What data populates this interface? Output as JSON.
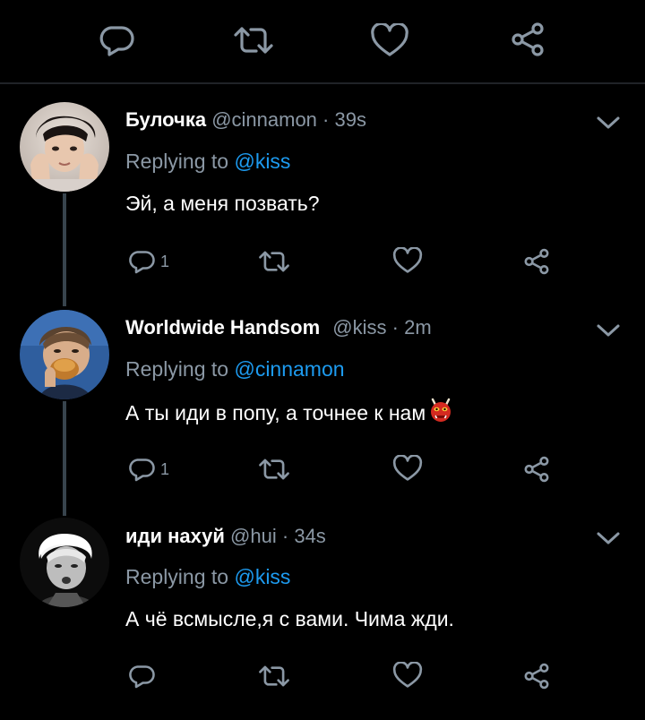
{
  "top_actions": {
    "reply_icon": "reply-icon",
    "retweet_icon": "retweet-icon",
    "like_icon": "like-icon",
    "share_icon": "share-icon"
  },
  "tweets": [
    {
      "name": "Булочка",
      "handle": "@cinnamon",
      "separator": "·",
      "time": "39s",
      "replying_prefix": "Replying to",
      "replying_to": "@kiss",
      "text": "Эй, а меня позвать?",
      "reply_count": "1",
      "retweet_count": "",
      "like_count": ""
    },
    {
      "name": "Worldwide Handsom",
      "handle": "@kiss",
      "separator": "·",
      "time": "2m",
      "replying_prefix": "Replying to",
      "replying_to": "@cinnamon",
      "text": "А ты иди в попу, а точнее к нам",
      "emoji": "ogre-mask-emoji",
      "reply_count": "1",
      "retweet_count": "",
      "like_count": ""
    },
    {
      "name": "иди нахуй",
      "handle": "@hui",
      "separator": "·",
      "time": "34s",
      "replying_prefix": "Replying to",
      "replying_to": "@kiss",
      "text": "А чё всмысле,я с вами. Чима жди.",
      "reply_count": "",
      "retweet_count": "",
      "like_count": ""
    }
  ],
  "colors": {
    "background": "#000000",
    "text_primary": "#ffffff",
    "text_secondary": "#8b98a5",
    "accent": "#1d9bf0",
    "thread_line": "#38444d",
    "divider": "#202327"
  }
}
